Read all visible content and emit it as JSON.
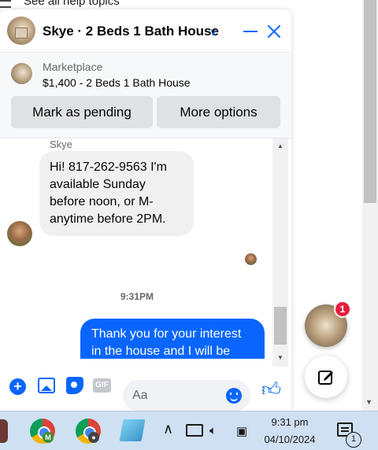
{
  "background_page": {
    "help_link": "See all help topics"
  },
  "chat": {
    "title": "Skye · 2 Beds 1 Bath House",
    "marketplace": {
      "label": "Marketplace",
      "listing": "$1,400 - 2 Beds 1 Bath House",
      "mark_pending_label": "Mark as pending",
      "more_options_label": "More options"
    },
    "messages": {
      "sender_name": "Skye",
      "incoming_text": "Hi! 817-262-9563 I'm available Sunday before noon, or M- anytime before 2PM.",
      "timestamp": "9:31PM",
      "outgoing_text": "Thank you for your interest in the house and I will be contact you soon"
    },
    "composer": {
      "placeholder": "Aa",
      "gif_label": "GIF"
    }
  },
  "chat_heads": {
    "unread_badge": "1"
  },
  "taskbar": {
    "clock_time": "9:31 pm",
    "clock_date": "04/10/2024",
    "notification_count": "1",
    "chrome_profile_1_badge": "M"
  },
  "colors": {
    "accent": "#0866ff",
    "badge": "#e41e3f",
    "taskbar": "#cfe0f3"
  }
}
